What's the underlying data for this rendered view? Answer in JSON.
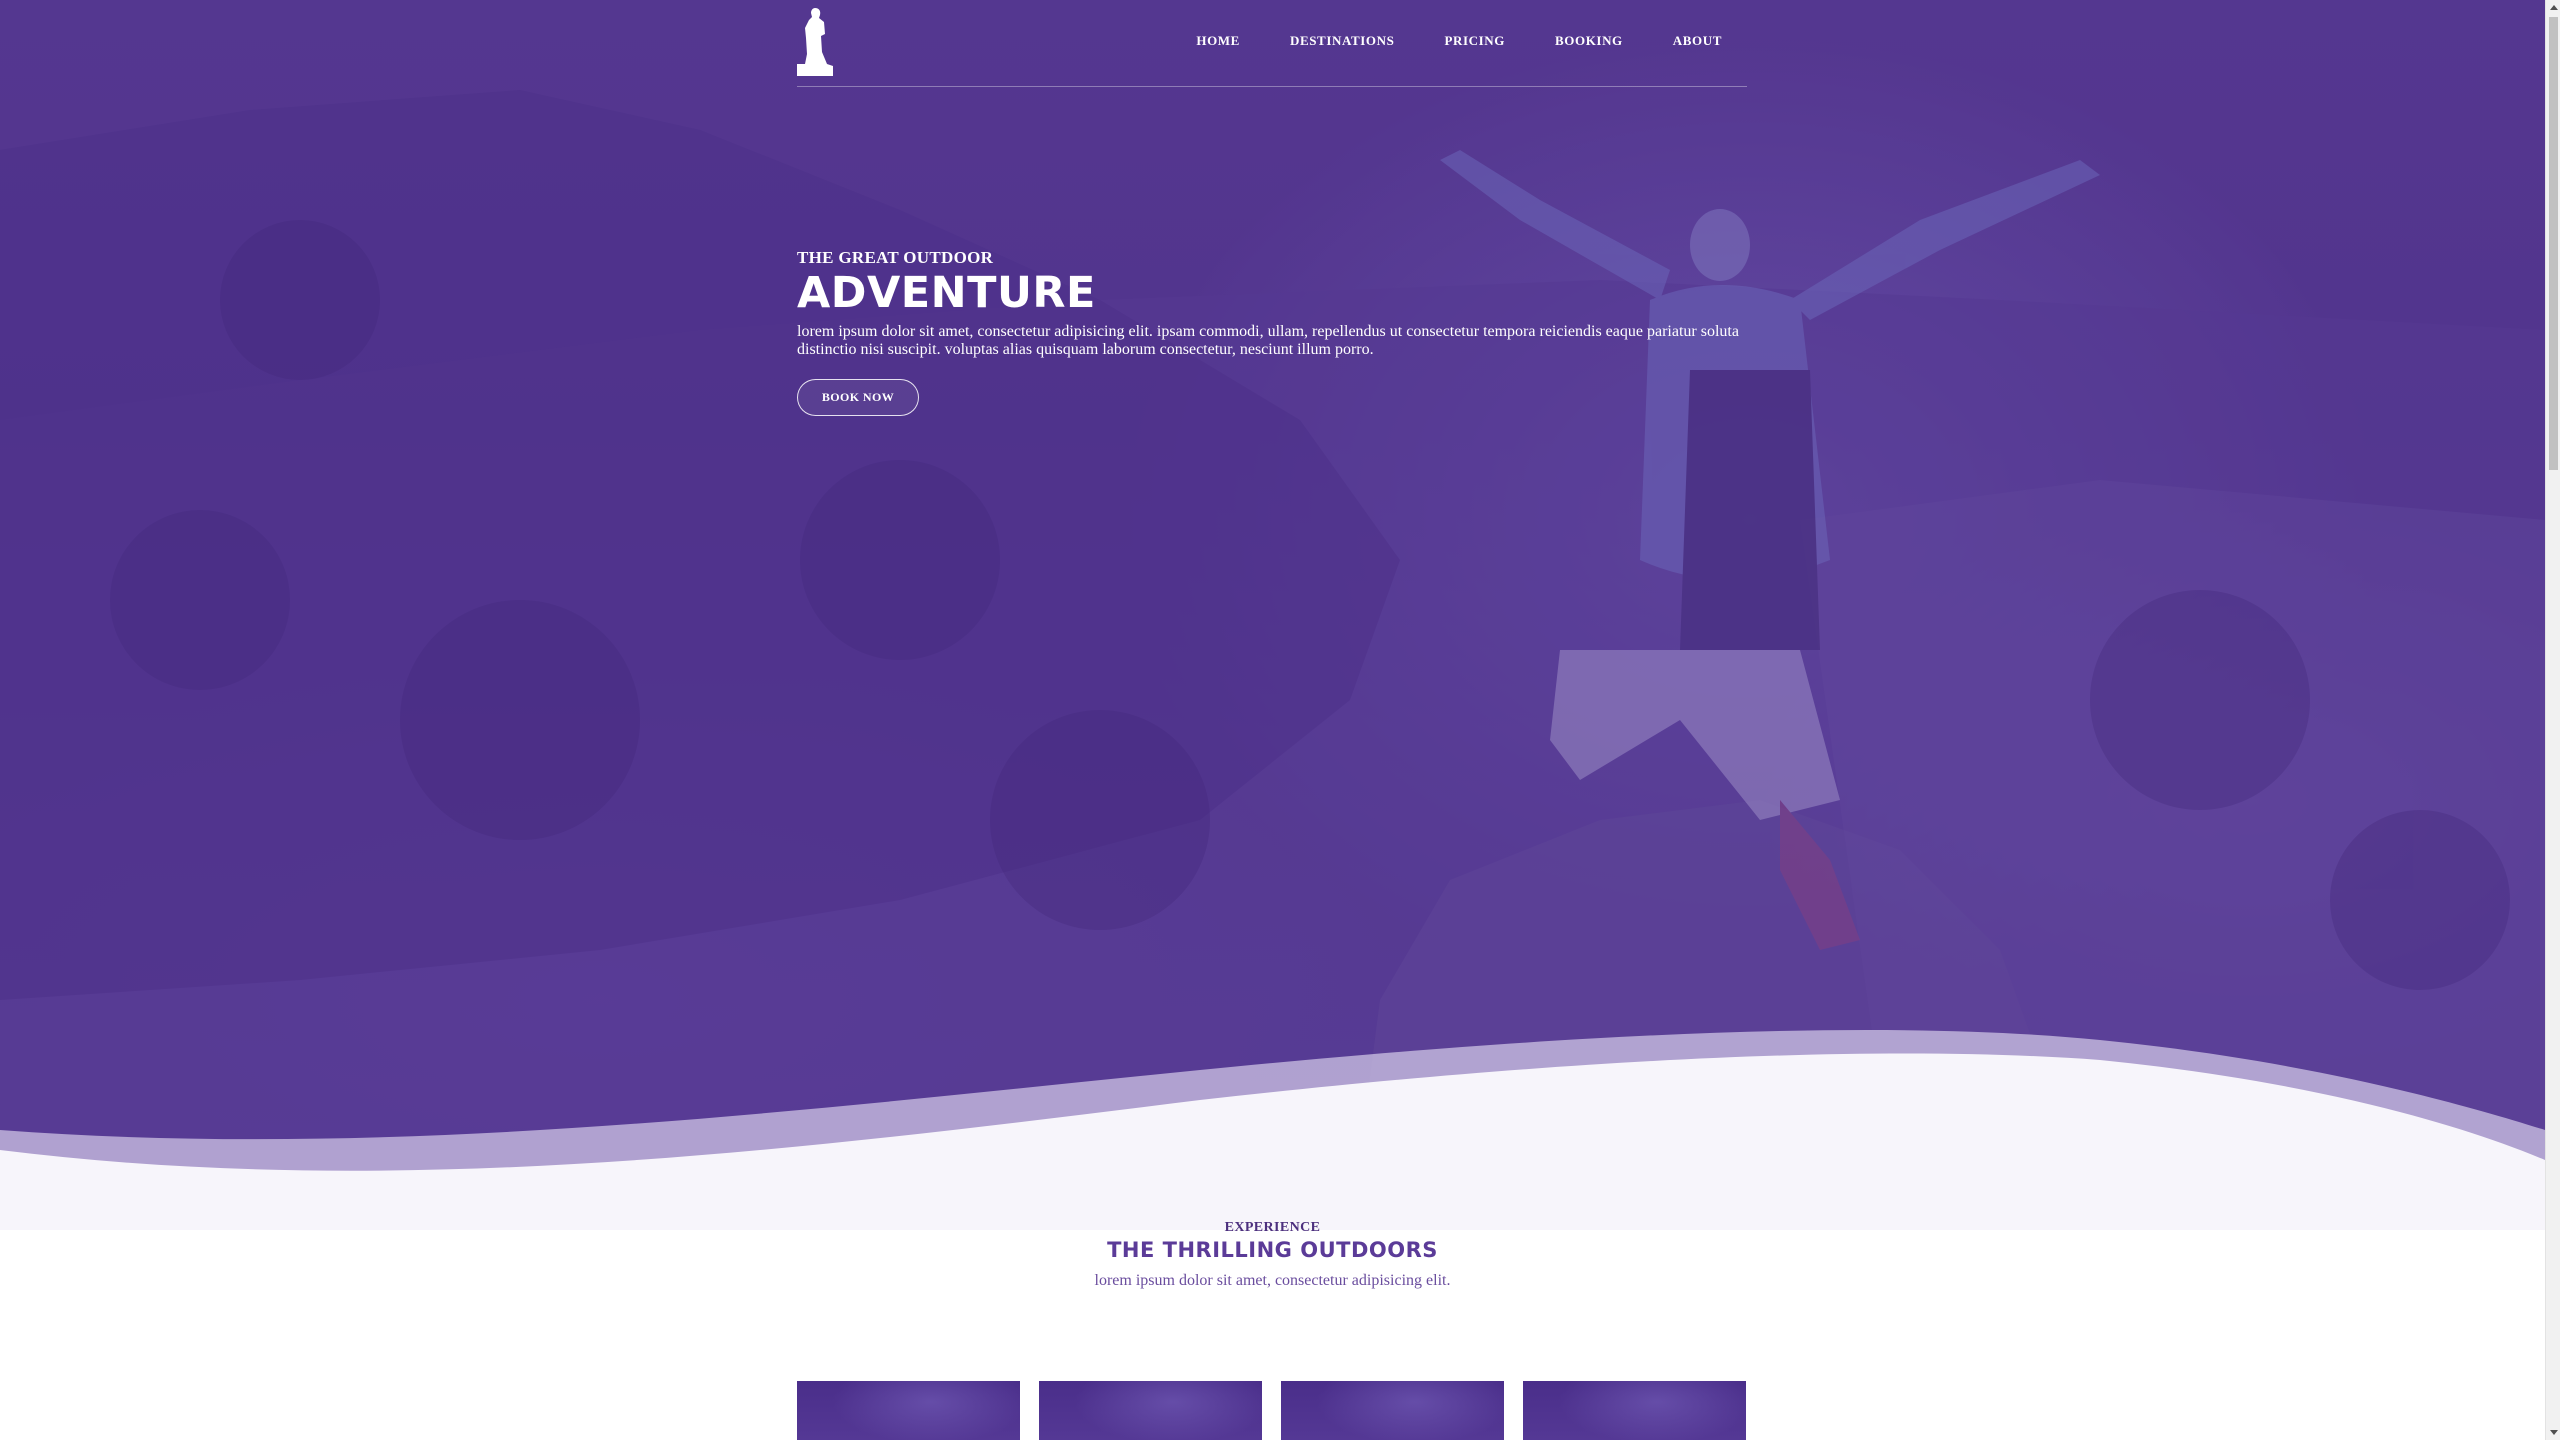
{
  "colors": {
    "hero_overlay": "#5a3f92",
    "accent": "#5b3b98",
    "text_on_dark": "#ffffff"
  },
  "header": {
    "logo_icon": "hiker-silhouette-icon",
    "nav": [
      {
        "label": "HOME"
      },
      {
        "label": "DESTINATIONS"
      },
      {
        "label": "PRICING"
      },
      {
        "label": "BOOKING"
      },
      {
        "label": "ABOUT"
      }
    ]
  },
  "hero": {
    "eyebrow": "THE GREAT OUTDOOR",
    "title": "ADVENTURE",
    "lead": "lorem ipsum dolor sit amet, consectetur adipisicing elit. ipsam commodi, ullam, repellendus ut consectetur tempora reiciendis eaque pariatur soluta distinctio nisi suscipit. voluptas alias quisquam laborum consectetur, nesciunt illum porro.",
    "cta_label": "BOOK NOW"
  },
  "section": {
    "eyebrow": "EXPERIENCE",
    "title": "THE THRILLING OUTDOORS",
    "lead": "lorem ipsum dolor sit amet, consectetur adipisicing elit."
  },
  "cards": [
    {
      "name": "card-1"
    },
    {
      "name": "card-2"
    },
    {
      "name": "card-3"
    },
    {
      "name": "card-4"
    }
  ]
}
